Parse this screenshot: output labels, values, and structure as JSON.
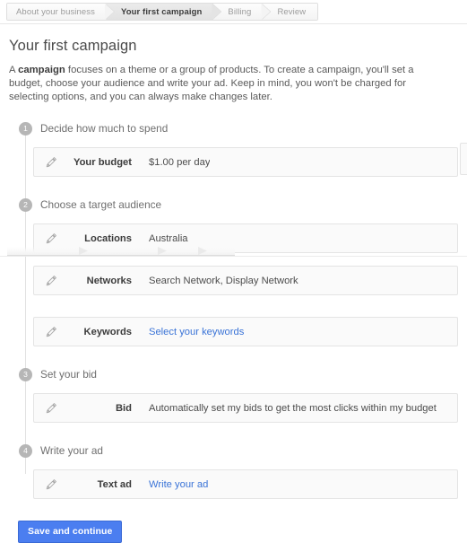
{
  "breadcrumb": {
    "steps": [
      {
        "label": "About your business",
        "state": "done"
      },
      {
        "label": "Your first campaign",
        "state": "active"
      },
      {
        "label": "Billing",
        "state": "upcoming"
      },
      {
        "label": "Review",
        "state": "upcoming"
      }
    ]
  },
  "page": {
    "title": "Your first campaign",
    "description_prefix": "A ",
    "description_bold": "campaign",
    "description_rest": " focuses on a theme or a group of products. To create a campaign, you'll set a budget, choose your audience and write your ad. Keep in mind, you won't be charged for selecting options, and you can always make changes later."
  },
  "steps": [
    {
      "number": "1",
      "title": "Decide how much to spend",
      "rows": [
        {
          "icon": "pencil-icon",
          "label": "Your budget",
          "value": "$1.00 per day",
          "is_link": false
        }
      ]
    },
    {
      "number": "2",
      "title": "Choose a target audience",
      "rows": [
        {
          "icon": "pencil-icon",
          "label": "Locations",
          "value": "Australia",
          "is_link": false
        },
        {
          "icon": "pencil-icon",
          "label": "Networks",
          "value": "Search Network, Display Network",
          "is_link": false
        },
        {
          "icon": "pencil-icon",
          "label": "Keywords",
          "value": "Select your keywords",
          "is_link": true
        }
      ]
    },
    {
      "number": "3",
      "title": "Set your bid",
      "rows": [
        {
          "icon": "pencil-icon",
          "label": "Bid",
          "value": "Automatically set my bids to get the most clicks within my budget",
          "is_link": false
        }
      ]
    },
    {
      "number": "4",
      "title": "Write your ad",
      "rows": [
        {
          "icon": "pencil-icon",
          "label": "Text ad",
          "value": "Write your ad",
          "is_link": true
        }
      ]
    }
  ],
  "footer": {
    "submit_label": "Save and continue"
  },
  "colors": {
    "link": "#3b74d7",
    "primary_button": "#4b7ef0",
    "step_circle": "#b6b6b6",
    "card_background": "#fafafa",
    "card_border": "#e4e4e4"
  }
}
